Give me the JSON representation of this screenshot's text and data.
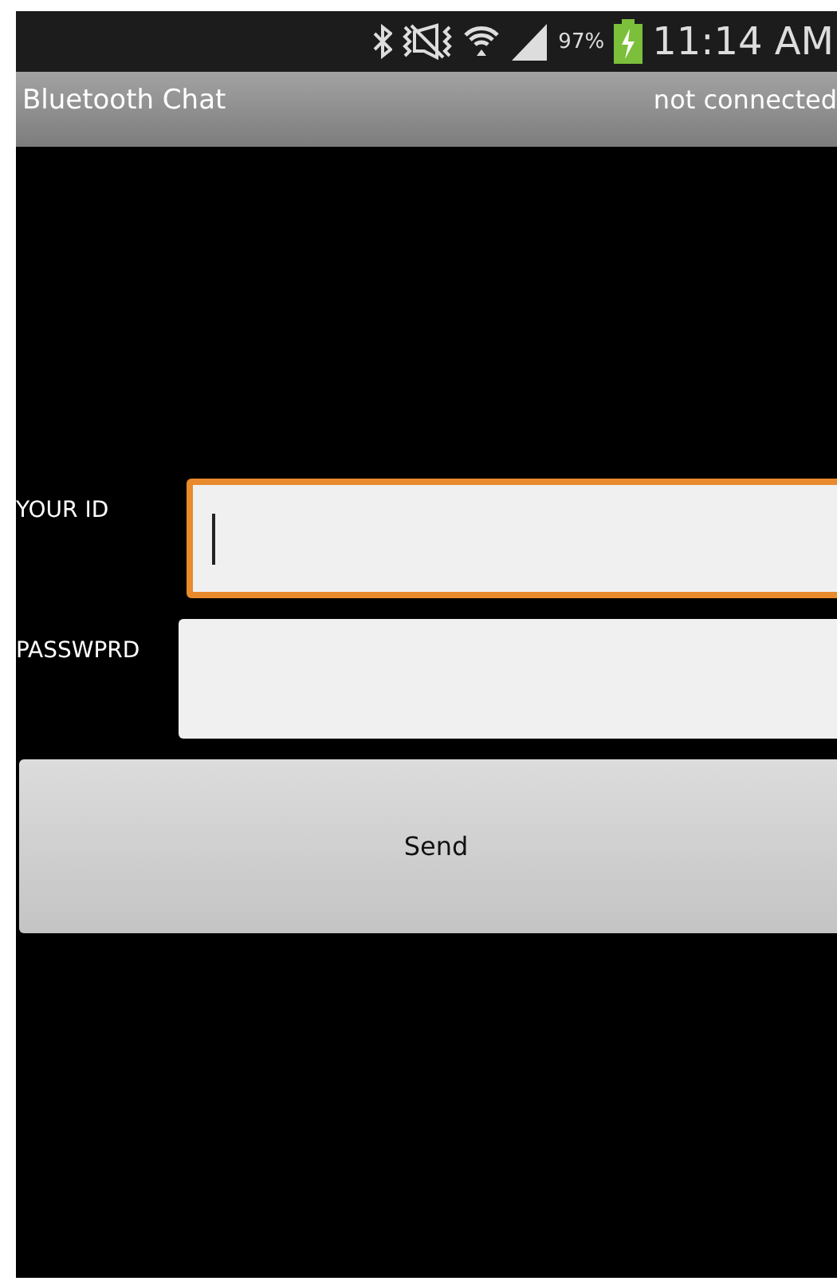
{
  "status_bar": {
    "battery_percent": "97%",
    "time": "11:14 AM"
  },
  "action_bar": {
    "title": "Bluetooth Chat",
    "status": "not connected"
  },
  "fields": [
    {
      "label": "YOUR ID",
      "focused": true
    },
    {
      "label": "PASSWPRD",
      "focused": false
    }
  ],
  "button": {
    "label": "Send"
  }
}
